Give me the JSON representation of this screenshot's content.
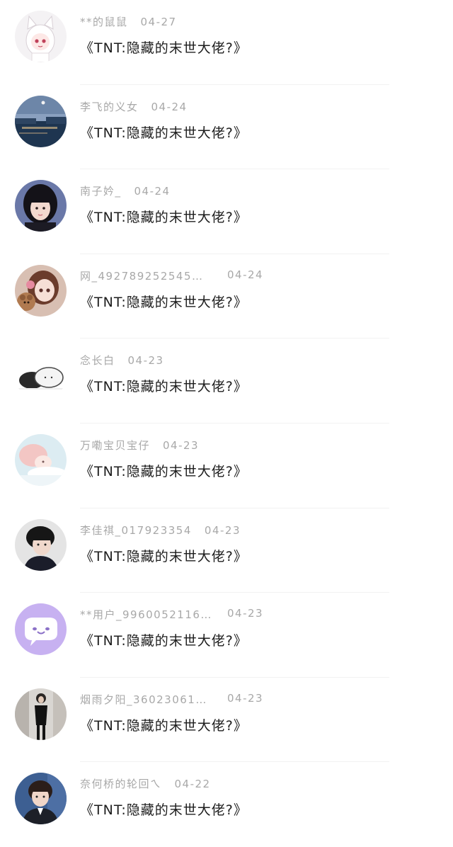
{
  "notifications": [
    {
      "name": "**的鼠鼠",
      "date": "04-27",
      "title": "《TNT:隐藏的末世大佬?》",
      "avatar": "anime-cat-girl"
    },
    {
      "name": "李飞的义女",
      "date": "04-24",
      "title": "《TNT:隐藏的末世大佬?》",
      "avatar": "night-harbor"
    },
    {
      "name": "南子妗_",
      "date": "04-24",
      "title": "《TNT:隐藏的末世大佬?》",
      "avatar": "girl-portrait"
    },
    {
      "name": "网_492789252545…",
      "date": "04-24",
      "title": "《TNT:隐藏的末世大佬?》",
      "avatar": "anime-girl-bear"
    },
    {
      "name": "念长白",
      "date": "04-23",
      "title": "《TNT:隐藏的末世大佬?》",
      "avatar": "mochi-cats"
    },
    {
      "name": "万嘞宝贝宝仔",
      "date": "04-23",
      "title": "《TNT:隐藏的末世大佬?》",
      "avatar": "pink-hair-girl"
    },
    {
      "name": "李佳祺_017923354",
      "date": "04-23",
      "title": "《TNT:隐藏的末世大佬?》",
      "avatar": "boy-hoodie"
    },
    {
      "name": "**用户_9960052116…",
      "date": "04-23",
      "title": "《TNT:隐藏的末世大佬?》",
      "avatar": "default-chat-bubble"
    },
    {
      "name": "烟雨夕阳_36023061…",
      "date": "04-23",
      "title": "《TNT:隐藏的末世大佬?》",
      "avatar": "woman-black-dress"
    },
    {
      "name": "奈何桥的轮回ㄟ",
      "date": "04-22",
      "title": "《TNT:隐藏的末世大佬?》",
      "avatar": "boy-suit"
    }
  ]
}
